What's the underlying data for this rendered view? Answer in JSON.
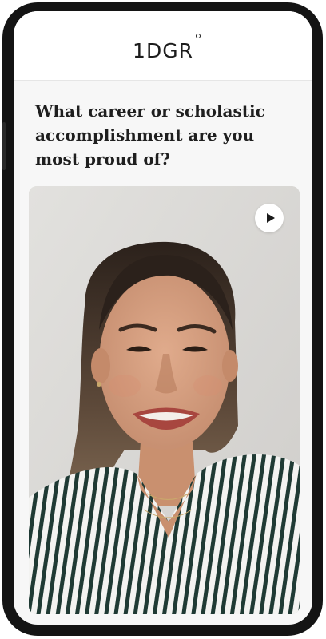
{
  "app": {
    "logo_text": "1DGR",
    "logo_mark": "degree-circle-icon"
  },
  "prompt": {
    "question": "What career or scholastic accomplishment are you most proud of?"
  },
  "video": {
    "description_icon": "portrait-video-thumbnail",
    "play_icon": "play-icon"
  },
  "colors": {
    "frame": "#141414",
    "screen_background": "#f7f7f7",
    "header_background": "#ffffff",
    "text": "#1f1f1f"
  }
}
